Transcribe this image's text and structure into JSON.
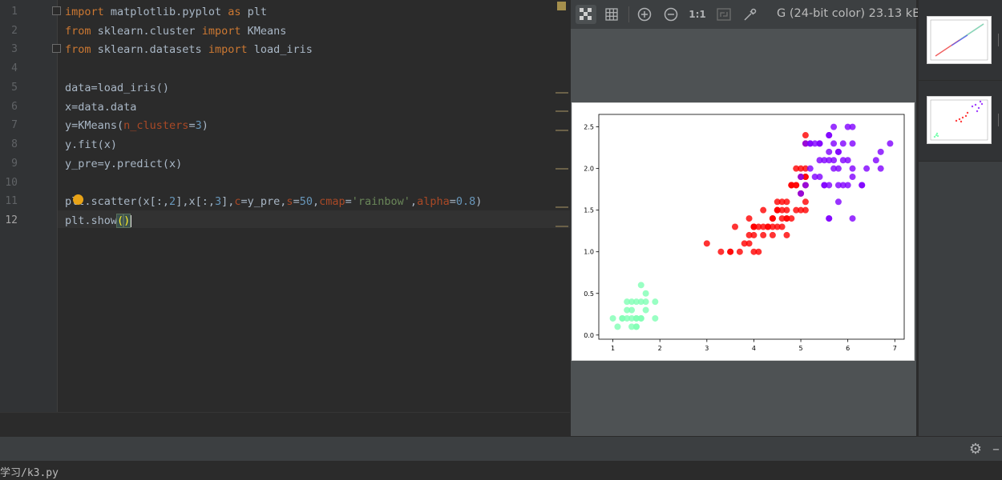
{
  "editor": {
    "line_numbers": [
      "1",
      "2",
      "3",
      "4",
      "5",
      "6",
      "7",
      "8",
      "9",
      "10",
      "11",
      "12"
    ],
    "code": {
      "l1": {
        "kw1": "import",
        "mod": " matplotlib.pyplot ",
        "kw2": "as",
        "rest": " plt"
      },
      "l2": {
        "kw1": "from",
        "mod": " sklearn.cluster ",
        "kw2": "import",
        "rest": " KMeans"
      },
      "l3": {
        "kw1": "from",
        "mod": " sklearn.datasets ",
        "kw2": "import",
        "rest": " load_iris"
      },
      "l5": "data=load_iris()",
      "l6": "x=data.data",
      "l7": {
        "a": "y=KMeans(",
        "param": "n_clusters",
        "eq": "=",
        "num": "3",
        "close": ")"
      },
      "l8": "y.fit(x)",
      "l9": "y_pre=y.predict(x)",
      "l11": {
        "a": "plt.scatter(x[:,",
        "n1": "2",
        "b": "],x[:,",
        "n2": "3",
        "c": "],",
        "p1": "c",
        "d": "=y_pre,",
        "p2": "s",
        "e": "=",
        "n3": "50",
        "f": ",",
        "p3": "cmap",
        "g": "=",
        "s1": "'rainbow'",
        "h": ",",
        "p4": "alpha",
        "i": "=",
        "n4": "0.8",
        "j": ")"
      },
      "l12": {
        "a": "plt.show",
        "paren_open": "(",
        "paren_close": ")"
      }
    }
  },
  "viewer": {
    "info": "G (24-bit color) 23.13 kB",
    "toolbar": {
      "grid_icon": "grid-icon",
      "zoom_in": "+",
      "zoom_out": "−",
      "actual_size": "1:1"
    }
  },
  "status": {
    "path": "学习/k3.py"
  },
  "chart_data": {
    "type": "scatter",
    "title": "",
    "xlabel": "",
    "ylabel": "",
    "xlim": [
      0.7,
      7.2
    ],
    "ylim": [
      -0.05,
      2.65
    ],
    "xticks": [
      1,
      2,
      3,
      4,
      5,
      6,
      7
    ],
    "yticks": [
      0.0,
      0.5,
      1.0,
      1.5,
      2.0,
      2.5
    ],
    "ytick_labels": [
      "0.0",
      "0.5",
      "1.0",
      "1.5",
      "2.0",
      "2.5"
    ],
    "grid": false,
    "alpha": 0.8,
    "series": [
      {
        "color": "#80ffb4",
        "points": [
          [
            1.4,
            0.2
          ],
          [
            1.3,
            0.2
          ],
          [
            1.5,
            0.2
          ],
          [
            1.7,
            0.4
          ],
          [
            1.4,
            0.3
          ],
          [
            1.5,
            0.1
          ],
          [
            1.6,
            0.2
          ],
          [
            1.1,
            0.1
          ],
          [
            1.2,
            0.2
          ],
          [
            1.5,
            0.4
          ],
          [
            1.3,
            0.4
          ],
          [
            1.7,
            0.3
          ],
          [
            1.0,
            0.2
          ],
          [
            1.7,
            0.5
          ],
          [
            1.9,
            0.2
          ],
          [
            1.6,
            0.4
          ],
          [
            1.5,
            0.2
          ],
          [
            1.4,
            0.1
          ],
          [
            1.6,
            0.6
          ],
          [
            1.9,
            0.4
          ],
          [
            1.6,
            0.2
          ],
          [
            1.3,
            0.3
          ],
          [
            1.5,
            0.1
          ],
          [
            1.4,
            0.4
          ],
          [
            1.2,
            0.2
          ]
        ]
      },
      {
        "color": "#ff0000",
        "points": [
          [
            4.7,
            1.4
          ],
          [
            4.5,
            1.5
          ],
          [
            4.0,
            1.3
          ],
          [
            4.6,
            1.5
          ],
          [
            4.5,
            1.3
          ],
          [
            3.3,
            1.0
          ],
          [
            4.6,
            1.3
          ],
          [
            3.9,
            1.4
          ],
          [
            3.5,
            1.0
          ],
          [
            4.2,
            1.5
          ],
          [
            4.0,
            1.0
          ],
          [
            4.7,
            1.4
          ],
          [
            3.6,
            1.3
          ],
          [
            4.4,
            1.4
          ],
          [
            4.1,
            1.0
          ],
          [
            4.5,
            1.5
          ],
          [
            3.9,
            1.1
          ],
          [
            4.8,
            1.8
          ],
          [
            4.0,
            1.3
          ],
          [
            4.9,
            1.5
          ],
          [
            4.7,
            1.2
          ],
          [
            4.3,
            1.3
          ],
          [
            4.4,
            1.4
          ],
          [
            4.8,
            1.4
          ],
          [
            5.0,
            1.7
          ],
          [
            4.5,
            1.5
          ],
          [
            3.5,
            1.0
          ],
          [
            3.8,
            1.1
          ],
          [
            3.7,
            1.0
          ],
          [
            3.9,
            1.2
          ],
          [
            5.1,
            1.6
          ],
          [
            4.5,
            1.6
          ],
          [
            4.7,
            1.5
          ],
          [
            4.4,
            1.3
          ],
          [
            4.1,
            1.3
          ],
          [
            4.0,
            1.3
          ],
          [
            4.4,
            1.2
          ],
          [
            4.6,
            1.4
          ],
          [
            4.0,
            1.2
          ],
          [
            3.0,
            1.1
          ],
          [
            4.2,
            1.3
          ],
          [
            4.2,
            1.2
          ],
          [
            4.3,
            1.3
          ],
          [
            5.1,
            1.9
          ],
          [
            4.9,
            1.8
          ],
          [
            5.0,
            1.5
          ],
          [
            4.9,
            2.0
          ],
          [
            5.0,
            2.0
          ],
          [
            5.1,
            2.0
          ],
          [
            5.1,
            1.5
          ],
          [
            4.8,
            1.8
          ],
          [
            5.1,
            2.4
          ],
          [
            5.1,
            1.8
          ],
          [
            4.8,
            1.8
          ],
          [
            4.9,
            1.8
          ],
          [
            5.0,
            1.9
          ],
          [
            4.7,
            1.6
          ],
          [
            5.1,
            1.9
          ],
          [
            5.1,
            2.3
          ],
          [
            4.6,
            1.6
          ],
          [
            4.4,
            1.4
          ]
        ]
      },
      {
        "color": "#8000ff",
        "points": [
          [
            6.0,
            2.5
          ],
          [
            5.9,
            2.1
          ],
          [
            5.6,
            1.8
          ],
          [
            5.8,
            2.2
          ],
          [
            6.6,
            2.1
          ],
          [
            6.3,
            1.8
          ],
          [
            5.8,
            1.8
          ],
          [
            6.1,
            2.5
          ],
          [
            5.3,
            1.9
          ],
          [
            5.5,
            2.1
          ],
          [
            5.2,
            2.3
          ],
          [
            5.4,
            2.3
          ],
          [
            6.7,
            2.2
          ],
          [
            6.9,
            2.3
          ],
          [
            5.7,
            2.3
          ],
          [
            6.7,
            2.0
          ],
          [
            5.7,
            2.1
          ],
          [
            6.0,
            1.8
          ],
          [
            5.6,
            2.1
          ],
          [
            5.8,
            1.6
          ],
          [
            6.1,
            1.9
          ],
          [
            6.4,
            2.0
          ],
          [
            5.6,
            2.2
          ],
          [
            6.1,
            1.4
          ],
          [
            5.6,
            2.4
          ],
          [
            5.5,
            1.8
          ],
          [
            5.4,
            2.1
          ],
          [
            5.6,
            2.4
          ],
          [
            5.1,
            2.3
          ],
          [
            5.9,
            2.3
          ],
          [
            5.7,
            2.5
          ],
          [
            5.2,
            2.3
          ],
          [
            5.0,
            1.9
          ],
          [
            5.2,
            2.0
          ],
          [
            5.4,
            2.3
          ],
          [
            5.1,
            1.8
          ],
          [
            5.6,
            1.4
          ],
          [
            6.1,
            2.3
          ],
          [
            6.3,
            1.8
          ],
          [
            5.6,
            1.4
          ],
          [
            5.0,
            1.7
          ],
          [
            5.8,
            2.2
          ],
          [
            5.3,
            2.3
          ],
          [
            6.0,
            2.1
          ],
          [
            6.1,
            2.0
          ],
          [
            5.7,
            2.0
          ],
          [
            5.5,
            1.8
          ],
          [
            5.9,
            1.8
          ],
          [
            5.4,
            1.9
          ],
          [
            5.8,
            2.0
          ]
        ]
      }
    ]
  }
}
